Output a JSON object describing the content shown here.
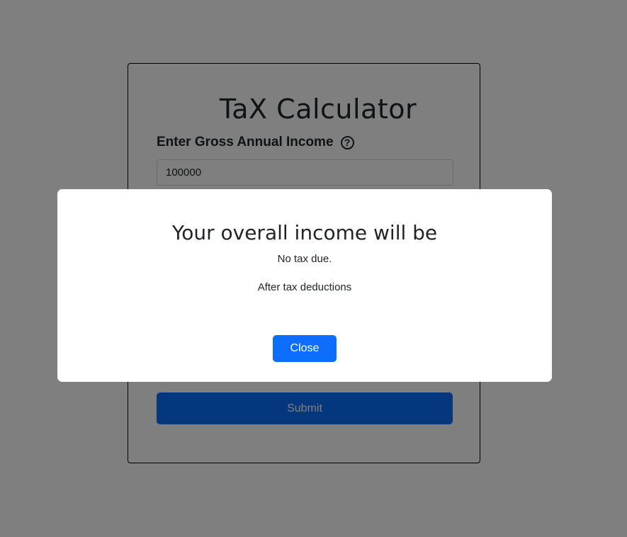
{
  "page": {
    "title": "TaX Calculator",
    "income_label": "Enter Gross Annual Income",
    "help_icon": "question-circle-icon",
    "income_value": "100000",
    "submit_label": "Submit"
  },
  "modal": {
    "title": "Your overall income will be",
    "line1": "No tax due.",
    "line2": "After tax deductions",
    "close_label": "Close"
  },
  "colors": {
    "primary": "#0d6efd",
    "backdrop": "rgba(0,0,0,0.5)",
    "text": "#212529"
  }
}
